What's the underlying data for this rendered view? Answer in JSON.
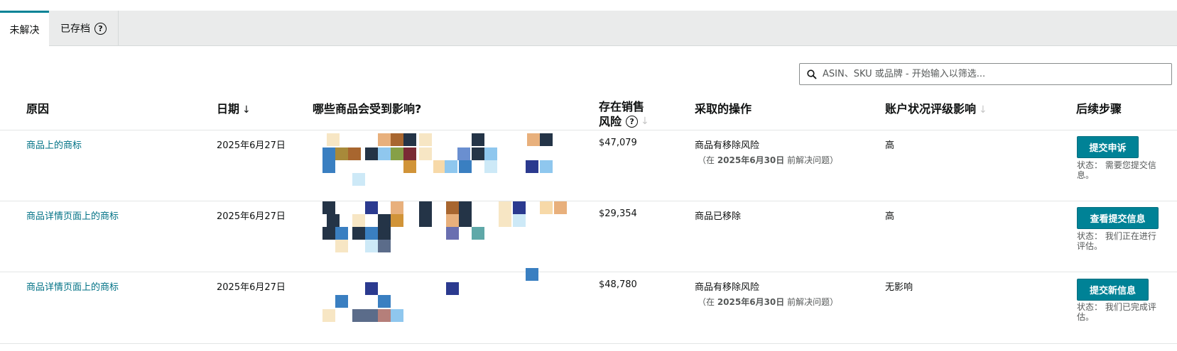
{
  "tabs": [
    {
      "label": "未解决",
      "active": true
    },
    {
      "label": "已存档",
      "active": false,
      "help_icon": "question-circle-icon"
    }
  ],
  "search": {
    "icon": "search-icon",
    "placeholder": "ASIN、SKU 或品牌 - 开始输入以筛选..."
  },
  "columns": {
    "reason": "原因",
    "date": "日期",
    "date_sort": "↓",
    "affected": "哪些商品会受到影响?",
    "sales_risk_line1": "存在销售",
    "sales_risk_line2": "风险",
    "sales_risk_sort": "↓",
    "action": "采取的操作",
    "impact": "账户状况评级影响",
    "impact_sort": "↓",
    "next_steps": "后续步骤"
  },
  "rows": [
    {
      "reason": "商品上的商标",
      "date": "2025年6月27日",
      "sales_risk": "$47,079",
      "action": "商品有移除风险",
      "action_note_prefix": "（在 ",
      "action_note_date": "2025年6月30日",
      "action_note_suffix": " 前解决问题）",
      "impact": "高",
      "button": "提交申诉",
      "status": "状态： 需要您提交信息。"
    },
    {
      "reason": "商品详情页面上的商标",
      "date": "2025年6月27日",
      "sales_risk": "$29,354",
      "action": "商品已移除",
      "action_note_prefix": "",
      "action_note_date": "",
      "action_note_suffix": "",
      "impact": "高",
      "button": "查看提交信息",
      "status": "状态： 我们正在进行评估。"
    },
    {
      "reason": "商品详情页面上的商标",
      "date": "2025年6月27日",
      "sales_risk": "$48,780",
      "action": "商品有移除风险",
      "action_note_prefix": "（在 ",
      "action_note_date": "2025年6月30日",
      "action_note_suffix": " 前解决问题）",
      "impact": "无影响",
      "button": "提交新信息",
      "status": "状态： 我们已完成评估。"
    }
  ],
  "colors": {
    "accent": "#008296",
    "link": "#007185",
    "tabbar_bg": "#eaebeb"
  }
}
